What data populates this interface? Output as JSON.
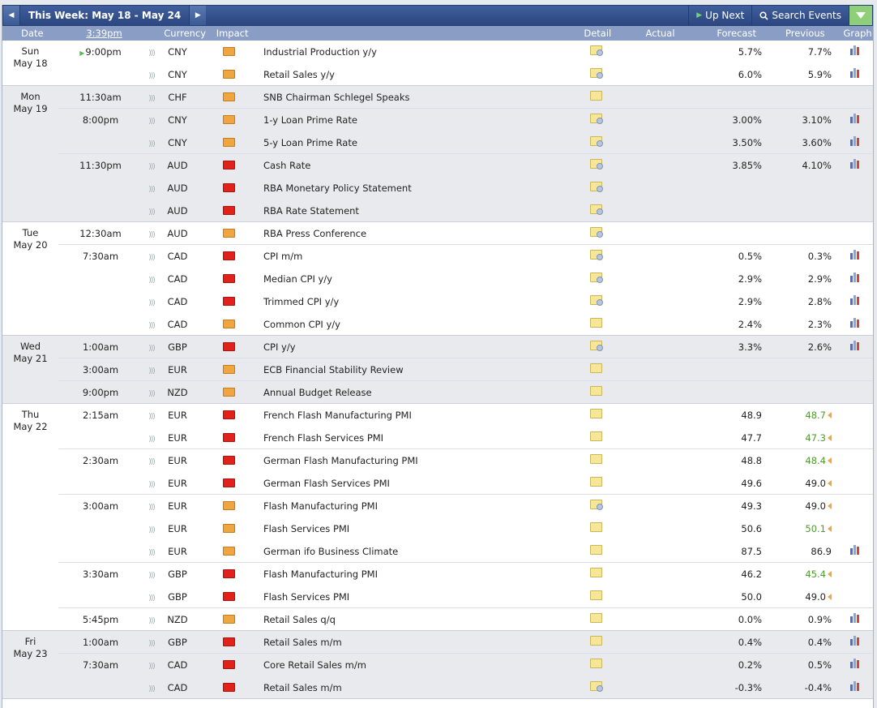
{
  "toolbar": {
    "week_title": "This Week: May 18 - May 24",
    "up_next": "Up Next",
    "search_events": "Search Events"
  },
  "header": {
    "date": "Date",
    "time": "3:39pm",
    "currency": "Currency",
    "impact": "Impact",
    "detail": "Detail",
    "actual": "Actual",
    "forecast": "Forecast",
    "previous": "Previous",
    "graph": "Graph"
  },
  "days": [
    {
      "day": "Sun",
      "date": "May 18",
      "rows": [
        {
          "time": "9:00pm",
          "current": true,
          "currency": "CNY",
          "impact": "med",
          "event": "Industrial Production y/y",
          "forecast": "5.7%",
          "previous": "7.7%",
          "graph": true,
          "detail": "sq"
        },
        {
          "time": "",
          "currency": "CNY",
          "impact": "med",
          "event": "Retail Sales y/y",
          "forecast": "6.0%",
          "previous": "5.9%",
          "graph": true,
          "detail": "sq"
        }
      ]
    },
    {
      "day": "Mon",
      "date": "May 19",
      "rows": [
        {
          "time": "11:30am",
          "currency": "CHF",
          "impact": "med",
          "event": "SNB Chairman Schlegel Speaks",
          "forecast": "",
          "previous": "",
          "graph": false,
          "detail": "plain"
        },
        {
          "time": "8:00pm",
          "currency": "CNY",
          "impact": "med",
          "event": "1-y Loan Prime Rate",
          "forecast": "3.00%",
          "previous": "3.10%",
          "graph": true,
          "detail": "sq"
        },
        {
          "time": "",
          "currency": "CNY",
          "impact": "med",
          "event": "5-y Loan Prime Rate",
          "forecast": "3.50%",
          "previous": "3.60%",
          "graph": true,
          "detail": "sq"
        },
        {
          "time": "11:30pm",
          "currency": "AUD",
          "impact": "high",
          "event": "Cash Rate",
          "forecast": "3.85%",
          "previous": "4.10%",
          "graph": true,
          "detail": "sq"
        },
        {
          "time": "",
          "currency": "AUD",
          "impact": "high",
          "event": "RBA Monetary Policy Statement",
          "forecast": "",
          "previous": "",
          "graph": false,
          "detail": "sq"
        },
        {
          "time": "",
          "currency": "AUD",
          "impact": "high",
          "event": "RBA Rate Statement",
          "forecast": "",
          "previous": "",
          "graph": false,
          "detail": "sq"
        }
      ]
    },
    {
      "day": "Tue",
      "date": "May 20",
      "rows": [
        {
          "time": "12:30am",
          "currency": "AUD",
          "impact": "med",
          "event": "RBA Press Conference",
          "forecast": "",
          "previous": "",
          "graph": false,
          "detail": "sq"
        },
        {
          "time": "7:30am",
          "currency": "CAD",
          "impact": "high",
          "event": "CPI m/m",
          "forecast": "0.5%",
          "previous": "0.3%",
          "graph": true,
          "detail": "sq"
        },
        {
          "time": "",
          "currency": "CAD",
          "impact": "high",
          "event": "Median CPI y/y",
          "forecast": "2.9%",
          "previous": "2.9%",
          "graph": true,
          "detail": "sq"
        },
        {
          "time": "",
          "currency": "CAD",
          "impact": "high",
          "event": "Trimmed CPI y/y",
          "forecast": "2.9%",
          "previous": "2.8%",
          "graph": true,
          "detail": "sq"
        },
        {
          "time": "",
          "currency": "CAD",
          "impact": "med",
          "event": "Common CPI y/y",
          "forecast": "2.4%",
          "previous": "2.3%",
          "graph": true,
          "detail": "plain"
        }
      ]
    },
    {
      "day": "Wed",
      "date": "May 21",
      "rows": [
        {
          "time": "1:00am",
          "currency": "GBP",
          "impact": "high",
          "event": "CPI y/y",
          "forecast": "3.3%",
          "previous": "2.6%",
          "graph": true,
          "detail": "sq"
        },
        {
          "time": "3:00am",
          "currency": "EUR",
          "impact": "med",
          "event": "ECB Financial Stability Review",
          "forecast": "",
          "previous": "",
          "graph": false,
          "detail": "plain"
        },
        {
          "time": "9:00pm",
          "currency": "NZD",
          "impact": "med",
          "event": "Annual Budget Release",
          "forecast": "",
          "previous": "",
          "graph": false,
          "detail": "plain"
        }
      ]
    },
    {
      "day": "Thu",
      "date": "May 22",
      "rows": [
        {
          "time": "2:15am",
          "currency": "EUR",
          "impact": "high",
          "event": "French Flash Manufacturing PMI",
          "forecast": "48.9",
          "previous": "48.7",
          "prev_revised": true,
          "graph": false,
          "detail": "plain"
        },
        {
          "time": "",
          "currency": "EUR",
          "impact": "high",
          "event": "French Flash Services PMI",
          "forecast": "47.7",
          "previous": "47.3",
          "prev_revised": true,
          "graph": false,
          "detail": "plain"
        },
        {
          "time": "2:30am",
          "currency": "EUR",
          "impact": "high",
          "event": "German Flash Manufacturing PMI",
          "forecast": "48.8",
          "previous": "48.4",
          "prev_revised": true,
          "graph": false,
          "detail": "plain"
        },
        {
          "time": "",
          "currency": "EUR",
          "impact": "high",
          "event": "German Flash Services PMI",
          "forecast": "49.6",
          "previous": "49.0",
          "prev_revised_down": true,
          "graph": false,
          "detail": "plain"
        },
        {
          "time": "3:00am",
          "currency": "EUR",
          "impact": "med",
          "event": "Flash Manufacturing PMI",
          "forecast": "49.3",
          "previous": "49.0",
          "prev_revised_down": true,
          "graph": false,
          "detail": "sq"
        },
        {
          "time": "",
          "currency": "EUR",
          "impact": "med",
          "event": "Flash Services PMI",
          "forecast": "50.6",
          "previous": "50.1",
          "prev_revised": true,
          "graph": false,
          "detail": "plain"
        },
        {
          "time": "",
          "currency": "EUR",
          "impact": "med",
          "event": "German ifo Business Climate",
          "forecast": "87.5",
          "previous": "86.9",
          "graph": true,
          "detail": "plain"
        },
        {
          "time": "3:30am",
          "currency": "GBP",
          "impact": "high",
          "event": "Flash Manufacturing PMI",
          "forecast": "46.2",
          "previous": "45.4",
          "prev_revised": true,
          "graph": false,
          "detail": "plain"
        },
        {
          "time": "",
          "currency": "GBP",
          "impact": "high",
          "event": "Flash Services PMI",
          "forecast": "50.0",
          "previous": "49.0",
          "prev_revised_down": true,
          "graph": false,
          "detail": "plain"
        },
        {
          "time": "5:45pm",
          "currency": "NZD",
          "impact": "med",
          "event": "Retail Sales q/q",
          "forecast": "0.0%",
          "previous": "0.9%",
          "graph": true,
          "detail": "plain"
        }
      ]
    },
    {
      "day": "Fri",
      "date": "May 23",
      "rows": [
        {
          "time": "1:00am",
          "currency": "GBP",
          "impact": "high",
          "event": "Retail Sales m/m",
          "forecast": "0.4%",
          "previous": "0.4%",
          "graph": true,
          "detail": "plain"
        },
        {
          "time": "7:30am",
          "currency": "CAD",
          "impact": "high",
          "event": "Core Retail Sales m/m",
          "forecast": "0.2%",
          "previous": "0.5%",
          "graph": true,
          "detail": "plain"
        },
        {
          "time": "",
          "currency": "CAD",
          "impact": "high",
          "event": "Retail Sales m/m",
          "forecast": "-0.3%",
          "previous": "-0.4%",
          "graph": true,
          "detail": "sq"
        }
      ]
    }
  ],
  "colors": {
    "nav_bg": "#2c4780",
    "header_bg": "#8a9dc4",
    "alt_day_bg": "#e8eaee",
    "impact_medium": "#f0a640",
    "impact_high": "#e0221a",
    "revised_up": "#4e9b2e"
  },
  "icons": {
    "prev_week": "chevron-left-icon",
    "next_week": "chevron-right-icon",
    "up_next": "play-icon",
    "search": "search-icon",
    "filter": "filter-icon",
    "sound": "sound-icon",
    "impact": "impact-folder-icon",
    "detail": "detail-folder-icon",
    "graph": "bar-chart-icon"
  }
}
